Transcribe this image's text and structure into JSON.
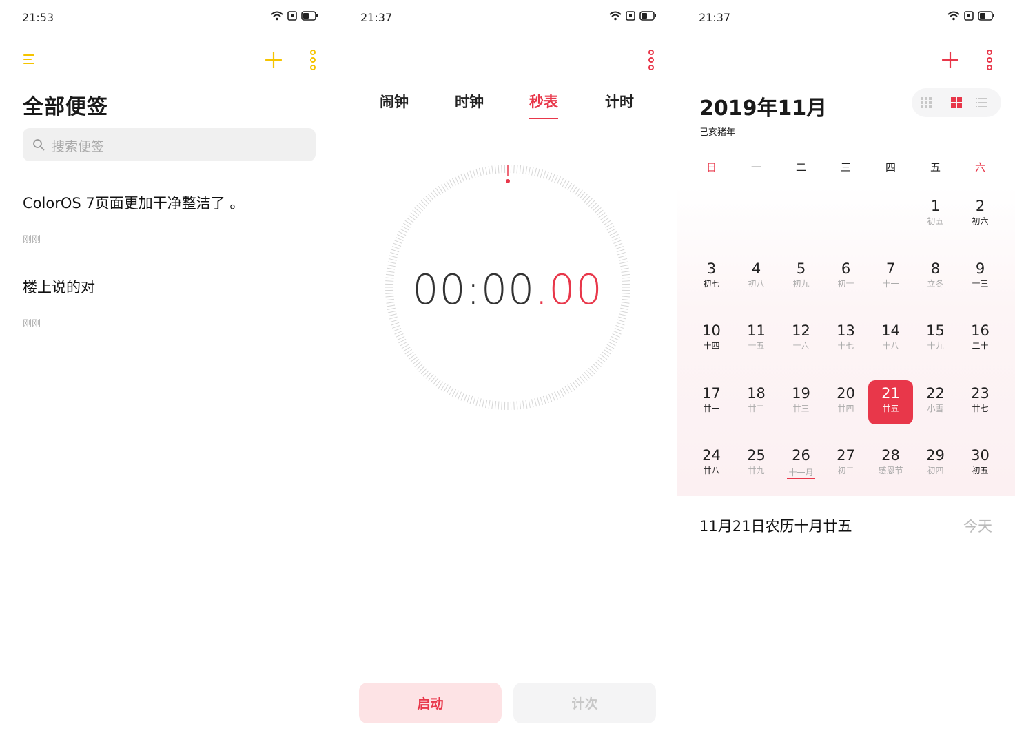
{
  "notes": {
    "status_time": "21:53",
    "title": "全部便签",
    "search_placeholder": "搜索便签",
    "items": [
      {
        "text": "ColorOS 7页面更加干净整洁了 。",
        "meta": "刚刚"
      },
      {
        "text": "楼上说的对",
        "meta": "刚刚"
      }
    ],
    "accent": "#f5c400"
  },
  "stopwatch": {
    "status_time": "21:37",
    "tabs": [
      "闹钟",
      "时钟",
      "秒表",
      "计时"
    ],
    "active_tab": "秒表",
    "time_main": "00:00",
    "time_dot": ".",
    "time_cs": "00",
    "start_label": "启动",
    "lap_label": "计次",
    "accent": "#e8374a"
  },
  "calendar": {
    "status_time": "21:37",
    "month_title": "2019年11月",
    "ganzhi_year": "己亥猪年",
    "weekdays": [
      "日",
      "一",
      "二",
      "三",
      "四",
      "五",
      "六"
    ],
    "selected_day": 21,
    "selected_text": "11月21日农历十月廿五",
    "today_label": "今天",
    "accent": "#e8374a",
    "days": [
      {
        "n": "1",
        "l": "初五",
        "col": 5,
        "row": 0
      },
      {
        "n": "2",
        "l": "初六",
        "col": 6,
        "row": 0,
        "dark": true
      },
      {
        "n": "3",
        "l": "初七",
        "col": 0,
        "row": 1,
        "dark": true
      },
      {
        "n": "4",
        "l": "初八",
        "col": 1,
        "row": 1
      },
      {
        "n": "5",
        "l": "初九",
        "col": 2,
        "row": 1
      },
      {
        "n": "6",
        "l": "初十",
        "col": 3,
        "row": 1
      },
      {
        "n": "7",
        "l": "十一",
        "col": 4,
        "row": 1
      },
      {
        "n": "8",
        "l": "立冬",
        "col": 5,
        "row": 1
      },
      {
        "n": "9",
        "l": "十三",
        "col": 6,
        "row": 1,
        "dark": true
      },
      {
        "n": "10",
        "l": "十四",
        "col": 0,
        "row": 2,
        "dark": true
      },
      {
        "n": "11",
        "l": "十五",
        "col": 1,
        "row": 2
      },
      {
        "n": "12",
        "l": "十六",
        "col": 2,
        "row": 2
      },
      {
        "n": "13",
        "l": "十七",
        "col": 3,
        "row": 2
      },
      {
        "n": "14",
        "l": "十八",
        "col": 4,
        "row": 2
      },
      {
        "n": "15",
        "l": "十九",
        "col": 5,
        "row": 2
      },
      {
        "n": "16",
        "l": "二十",
        "col": 6,
        "row": 2,
        "dark": true
      },
      {
        "n": "17",
        "l": "廿一",
        "col": 0,
        "row": 3,
        "dark": true
      },
      {
        "n": "18",
        "l": "廿二",
        "col": 1,
        "row": 3
      },
      {
        "n": "19",
        "l": "廿三",
        "col": 2,
        "row": 3
      },
      {
        "n": "20",
        "l": "廿四",
        "col": 3,
        "row": 3
      },
      {
        "n": "21",
        "l": "廿五",
        "col": 4,
        "row": 3,
        "sel": true
      },
      {
        "n": "22",
        "l": "小雪",
        "col": 5,
        "row": 3
      },
      {
        "n": "23",
        "l": "廿七",
        "col": 6,
        "row": 3,
        "dark": true
      },
      {
        "n": "24",
        "l": "廿八",
        "col": 0,
        "row": 4,
        "dark": true
      },
      {
        "n": "25",
        "l": "廿九",
        "col": 1,
        "row": 4
      },
      {
        "n": "26",
        "l": "十一月",
        "col": 2,
        "row": 4,
        "mark": true
      },
      {
        "n": "27",
        "l": "初二",
        "col": 3,
        "row": 4
      },
      {
        "n": "28",
        "l": "感恩节",
        "col": 4,
        "row": 4
      },
      {
        "n": "29",
        "l": "初四",
        "col": 5,
        "row": 4
      },
      {
        "n": "30",
        "l": "初五",
        "col": 6,
        "row": 4,
        "dark": true
      }
    ]
  }
}
